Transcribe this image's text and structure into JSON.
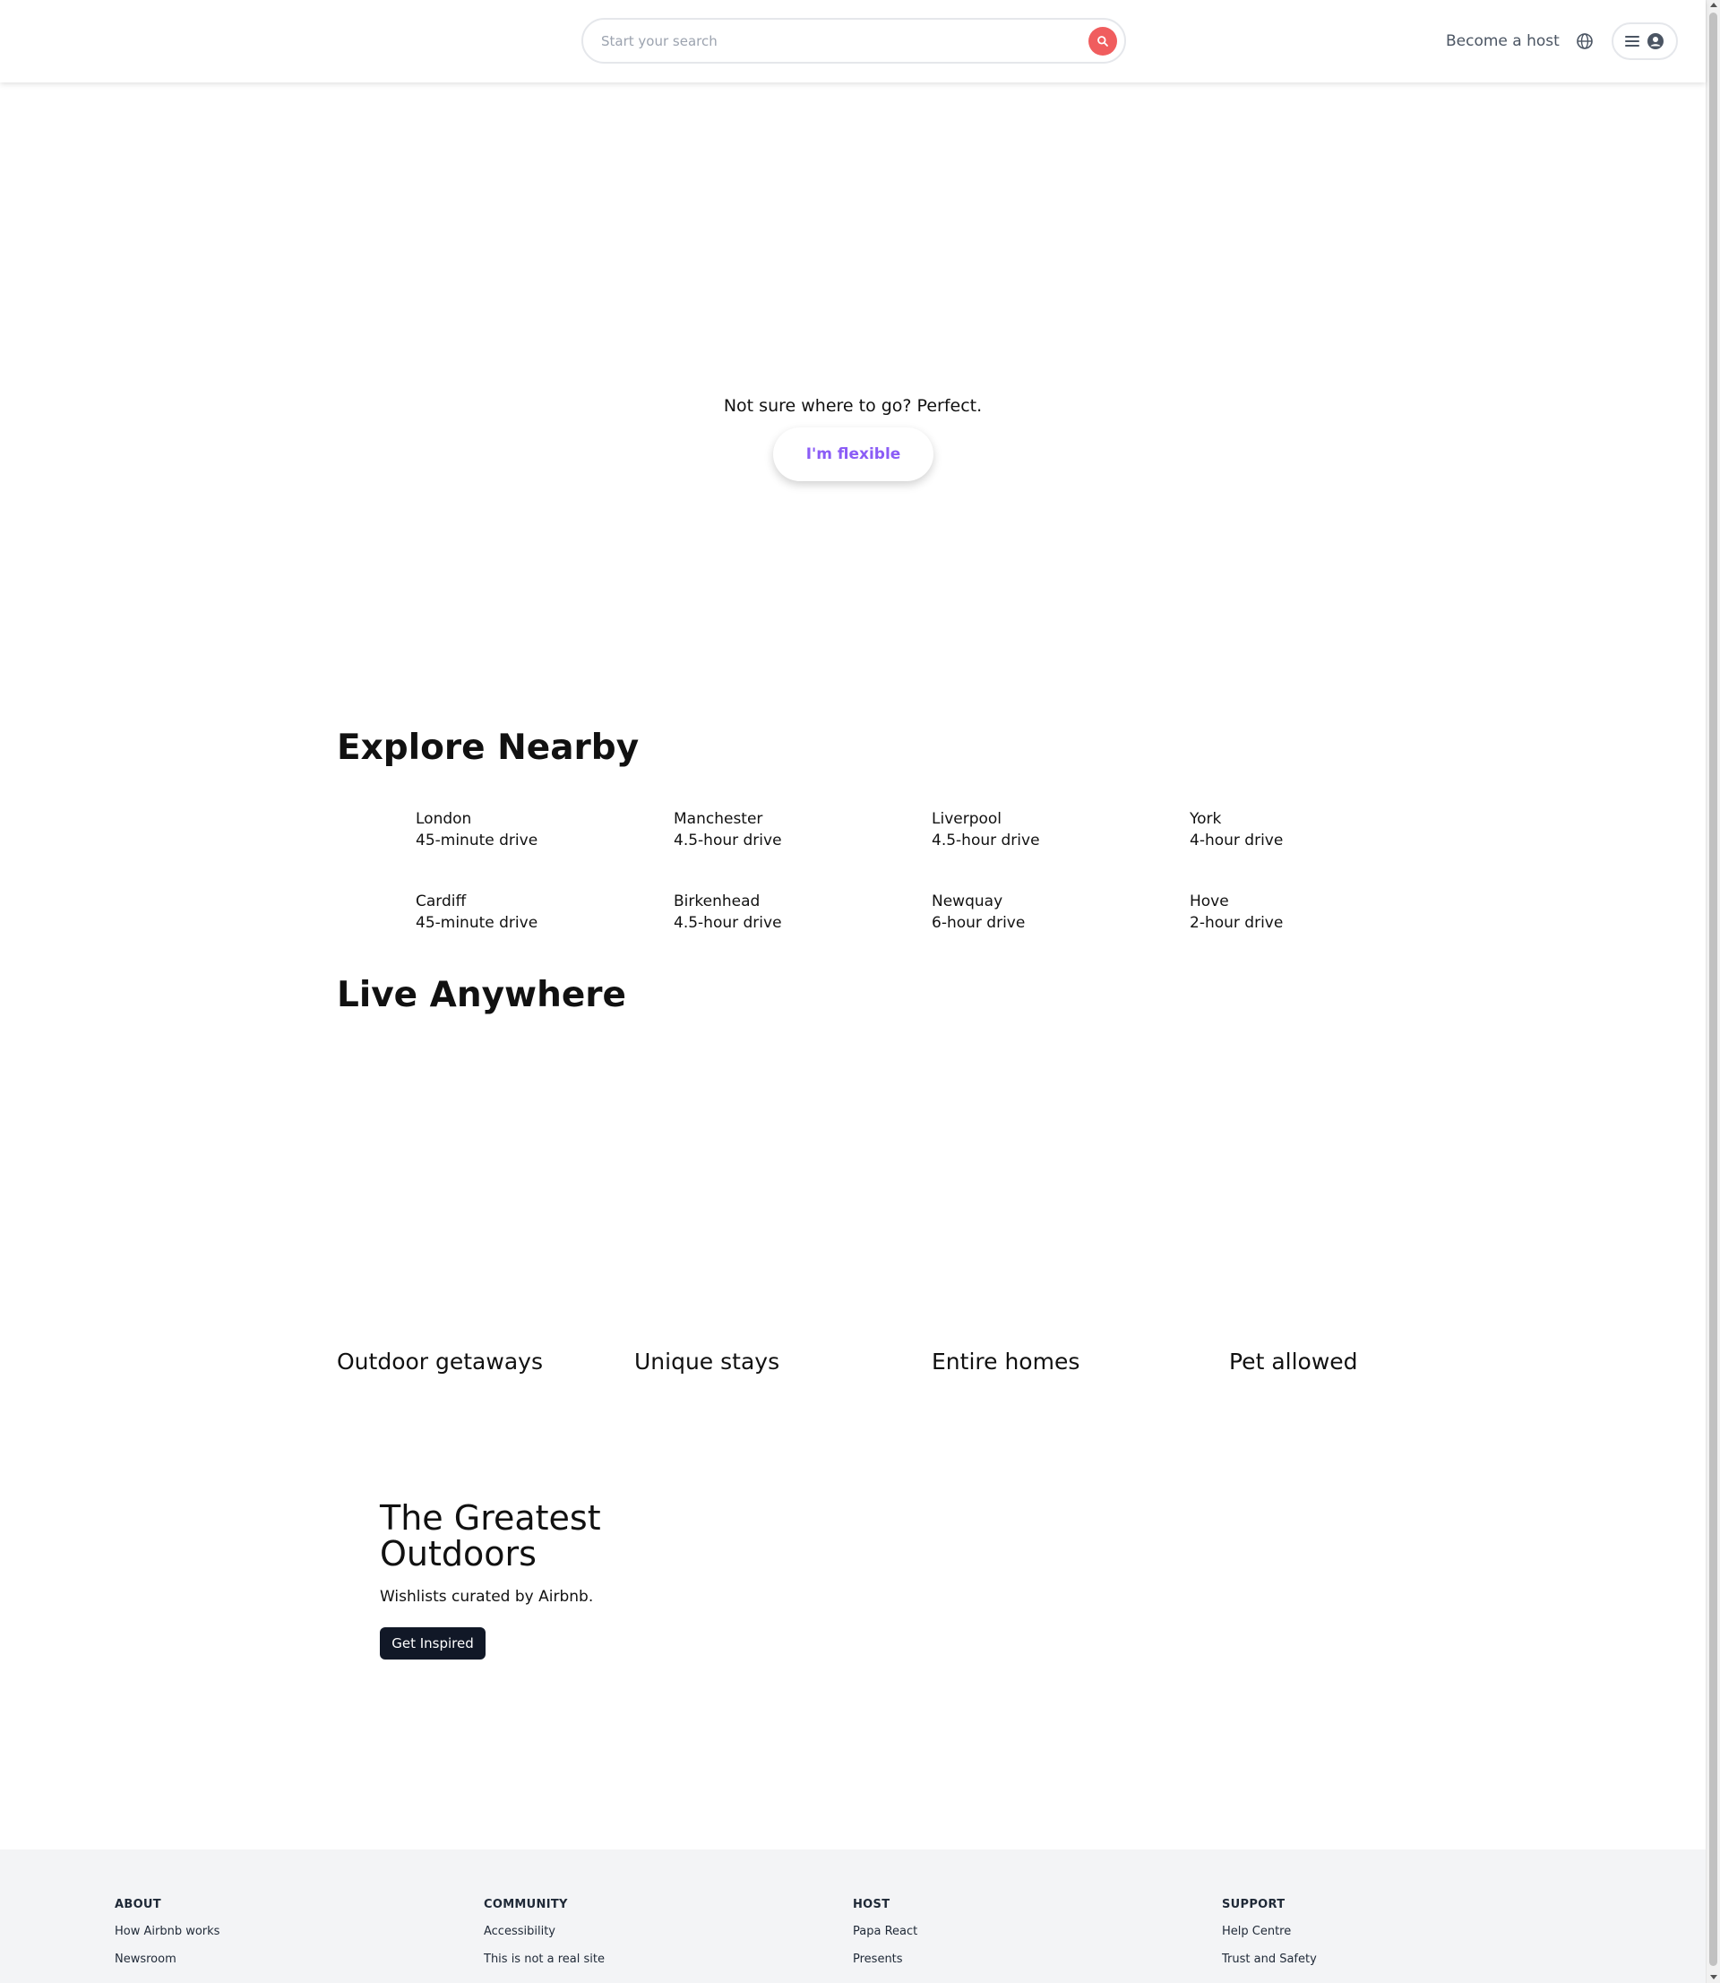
{
  "header": {
    "search": {
      "placeholder": "Start your search"
    },
    "become_host": "Become a host"
  },
  "hero": {
    "text": "Not sure where to go? Perfect.",
    "button": "I'm flexible"
  },
  "explore": {
    "title": "Explore Nearby",
    "items": [
      {
        "city": "London",
        "drive": "45-minute drive"
      },
      {
        "city": "Manchester",
        "drive": "4.5-hour drive"
      },
      {
        "city": "Liverpool",
        "drive": "4.5-hour drive"
      },
      {
        "city": "York",
        "drive": "4-hour drive"
      },
      {
        "city": "Cardiff",
        "drive": "45-minute drive"
      },
      {
        "city": "Birkenhead",
        "drive": "4.5-hour drive"
      },
      {
        "city": "Newquay",
        "drive": "6-hour drive"
      },
      {
        "city": "Hove",
        "drive": "2-hour drive"
      }
    ]
  },
  "live": {
    "title": "Live Anywhere",
    "cards": [
      "Outdoor getaways",
      "Unique stays",
      "Entire homes",
      "Pet allowed"
    ]
  },
  "banner": {
    "title": "The Greatest Outdoors",
    "subtitle": "Wishlists curated by Airbnb.",
    "button": "Get Inspired"
  },
  "footer": {
    "columns": [
      {
        "heading": "ABOUT",
        "links": [
          "How Airbnb works",
          "Newsroom"
        ]
      },
      {
        "heading": "COMMUNITY",
        "links": [
          "Accessibility",
          "This is not a real site"
        ]
      },
      {
        "heading": "HOST",
        "links": [
          "Papa React",
          "Presents"
        ]
      },
      {
        "heading": "SUPPORT",
        "links": [
          "Help Centre",
          "Trust and Safety"
        ]
      }
    ]
  },
  "colors": {
    "search_button": "#f05d5e",
    "flexible_text": "#8b5cf6",
    "dark_button": "#111827",
    "footer_bg": "#f3f4f6"
  }
}
